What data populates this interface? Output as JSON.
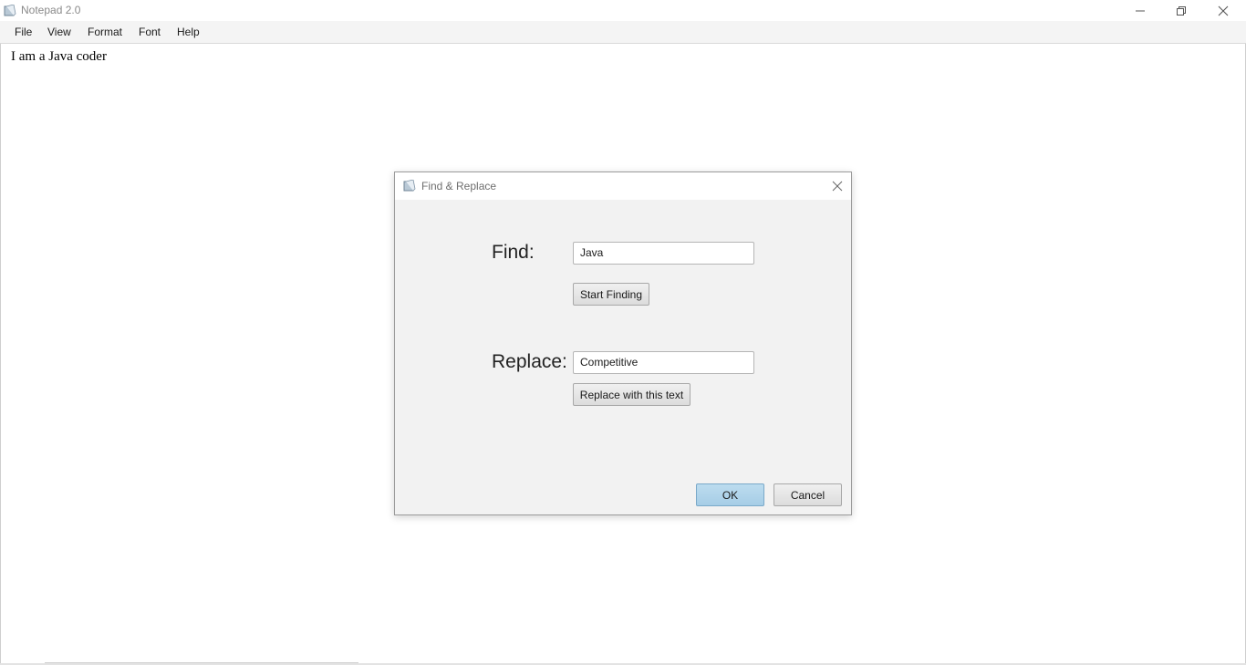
{
  "window": {
    "title": "Notepad 2.0"
  },
  "menu": {
    "items": [
      {
        "label": "File"
      },
      {
        "label": "View"
      },
      {
        "label": "Format"
      },
      {
        "label": "Font"
      },
      {
        "label": "Help"
      }
    ]
  },
  "editor": {
    "content": "I am a Java coder"
  },
  "dialog": {
    "title": "Find & Replace",
    "find_label": "Find:",
    "find_value": "Java",
    "start_finding_label": "Start Finding",
    "replace_label": "Replace:",
    "replace_value": "Competitive",
    "replace_button_label": "Replace with this text",
    "ok_label": "OK",
    "cancel_label": "Cancel"
  },
  "icons": {
    "app": "notepad-app-icon",
    "minimize": "minimize-icon",
    "maximize": "restore-icon",
    "close": "close-icon",
    "dialog_close": "close-icon"
  },
  "colors": {
    "ok_button": "#a6cde6",
    "dialog_background": "#f2f2f2",
    "menubar_background": "#f4f4f4"
  }
}
